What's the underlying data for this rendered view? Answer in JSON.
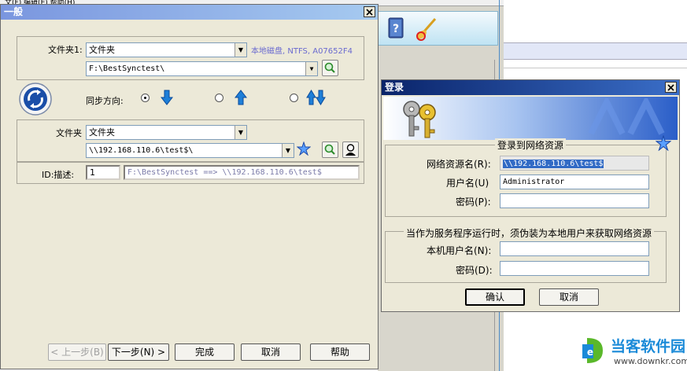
{
  "bg_menu": {
    "text": "文(F)  编辑(E)  帮助(H)"
  },
  "main_dialog": {
    "title": "一般",
    "folder1": {
      "label": "文件夹1:",
      "type_value": "文件夹",
      "disk_info": "本地磁盘, NTFS, A07652F4",
      "path_value": "F:\\BestSynctest\\"
    },
    "sync_direction": {
      "label": "同步方向:"
    },
    "folder2": {
      "label": "文件夹",
      "type_value": "文件夹",
      "path_value": "\\\\192.168.110.6\\test$\\"
    },
    "id_row": {
      "label": "ID:描述:",
      "id_value": "1",
      "desc_value": "F:\\BestSynctest ==> \\\\192.168.110.6\\test$"
    },
    "buttons": {
      "back": "< 上一步(B)",
      "next": "下一步(N) >",
      "finish": "完成",
      "cancel": "取消",
      "help": "帮助"
    }
  },
  "login_dialog": {
    "title": "登录",
    "group1_title": "登录到网络资源",
    "resource_label": "网络资源名(R):",
    "resource_value": "\\\\192.168.110.6\\test$",
    "user_label": "用户名(U)",
    "user_value": "Administrator",
    "password_label": "密码(P):",
    "password_value": "",
    "group2_title": "当作为服务程序运行时，须伪装为本地用户来获取网络资源",
    "local_user_label": "本机用户名(N):",
    "local_user_value": "",
    "local_password_label": "密码(D):",
    "local_password_value": "",
    "ok": "确认",
    "cancel": "取消"
  },
  "watermark": {
    "brand": "当客软件园",
    "url": "www.downkr.com"
  },
  "colors": {
    "titlebar_active": "#0a246a",
    "titlebar_inactive": "#7a96df",
    "dialog_bg": "#ece9d8",
    "disk_info_text": "#6a6ad0",
    "desc_text": "#7a7aa8",
    "arrow_blue": "#1e7fd8"
  }
}
